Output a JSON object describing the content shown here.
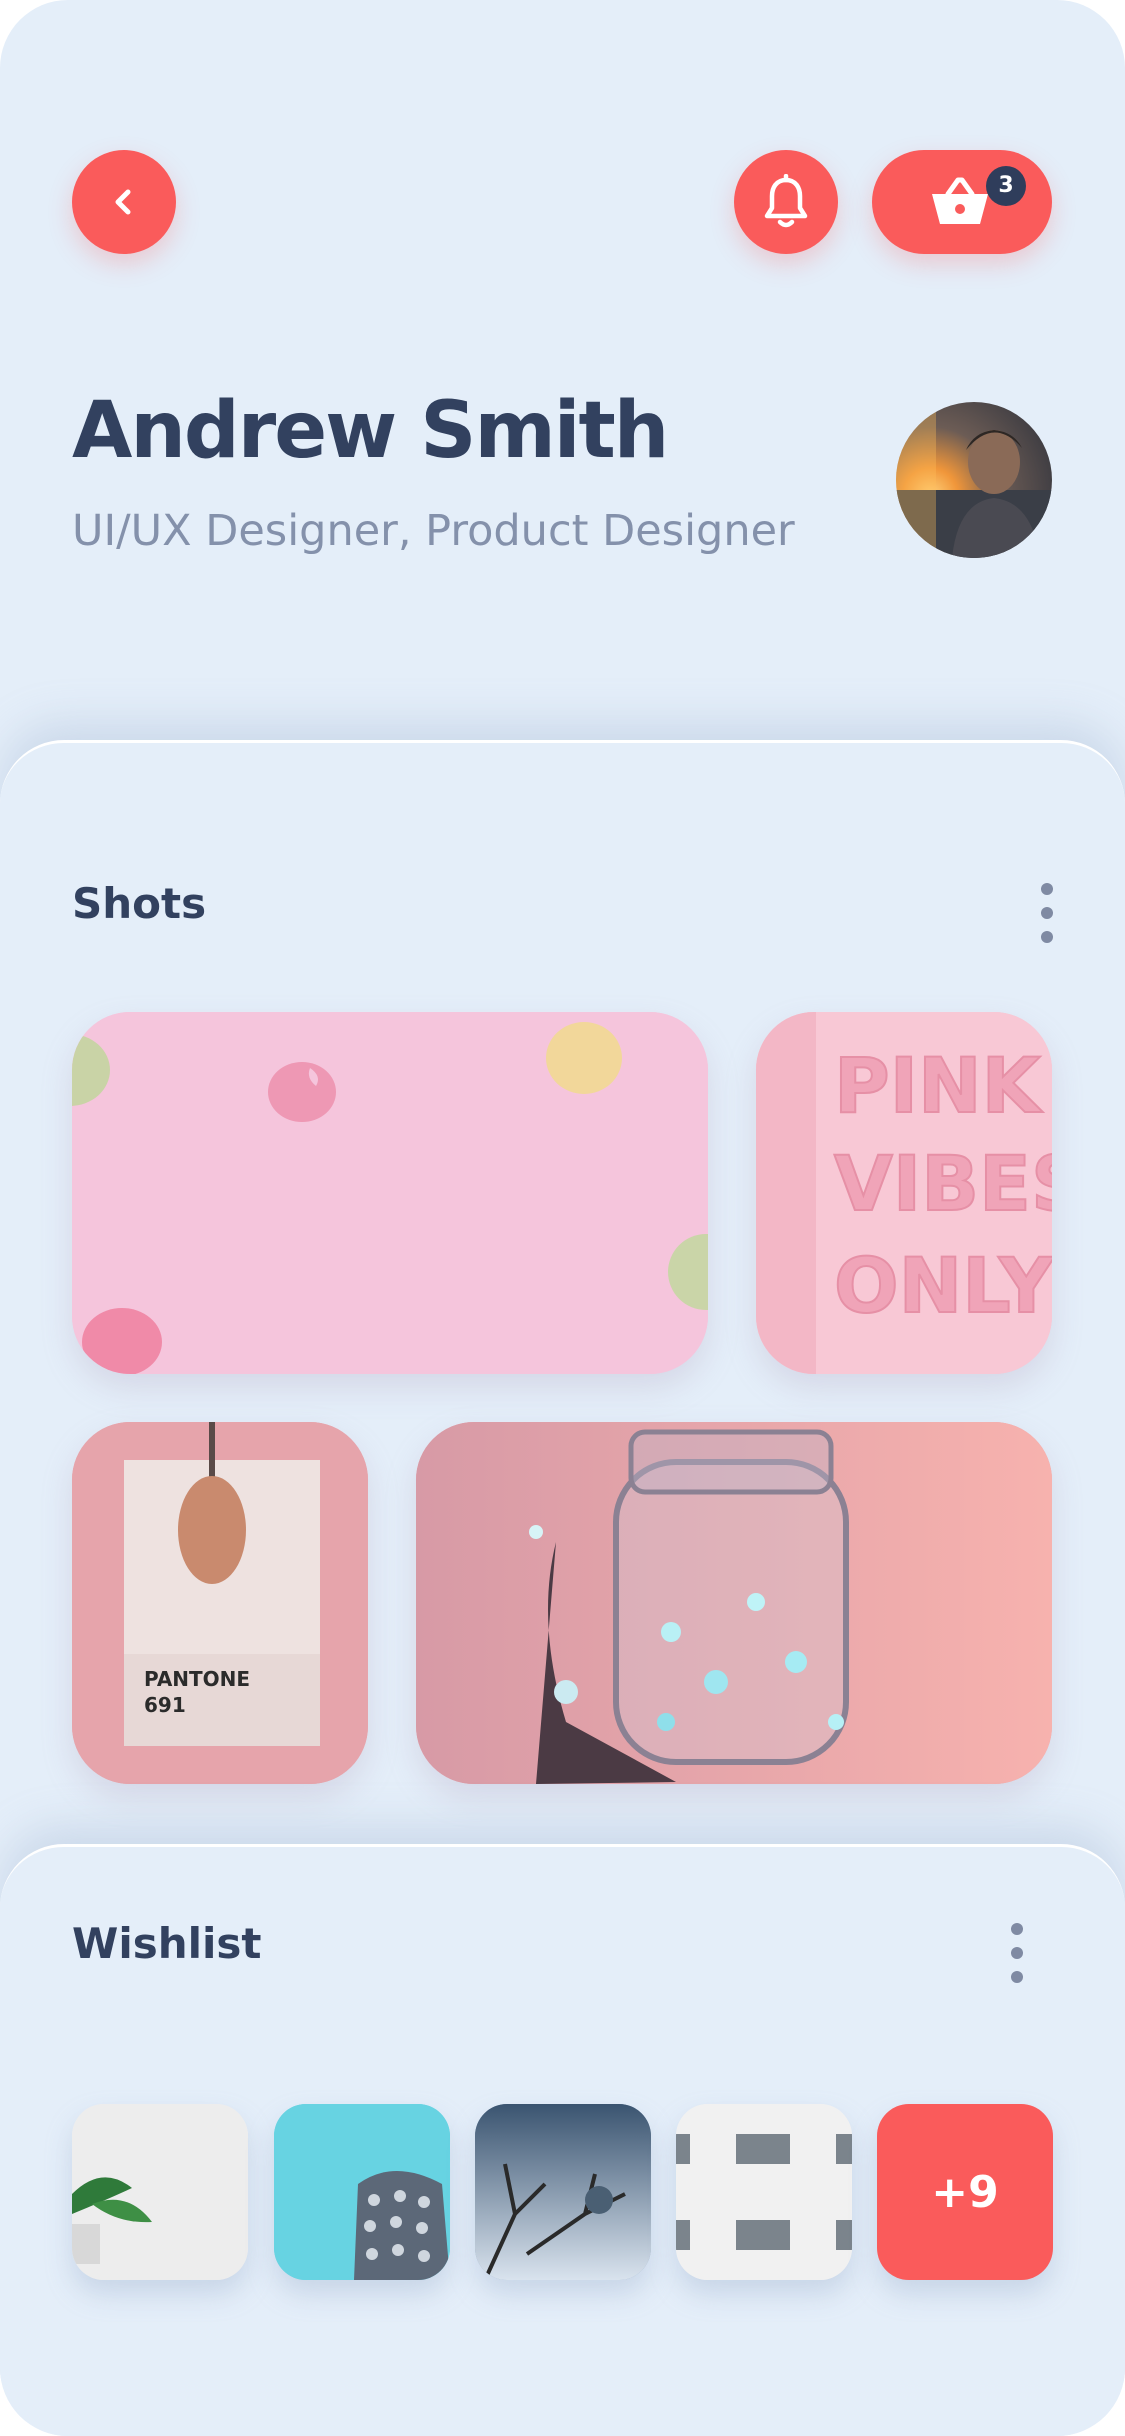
{
  "header": {
    "back_icon": "chevron-left-icon",
    "notification_icon": "bell-icon",
    "cart_icon": "basket-icon",
    "cart_count": "3",
    "accent_color": "#fa5b5b"
  },
  "profile": {
    "name": "Andrew Smith",
    "role": "UI/UX Designer, Product Designer"
  },
  "shots": {
    "title": "Shots",
    "more_icon": "more-vertical-icon",
    "items": [
      {
        "subject": "macarons"
      },
      {
        "subject": "pink-vibes-sign",
        "text_lines": [
          "PINK",
          "VIBES",
          "ONLY"
        ]
      },
      {
        "subject": "pantone-spoon",
        "text_lines": [
          "PANTONE",
          "691"
        ]
      },
      {
        "subject": "fairy-light-jar"
      }
    ]
  },
  "wishlist": {
    "title": "Wishlist",
    "more_icon": "more-vertical-icon",
    "more_count": "+9"
  }
}
